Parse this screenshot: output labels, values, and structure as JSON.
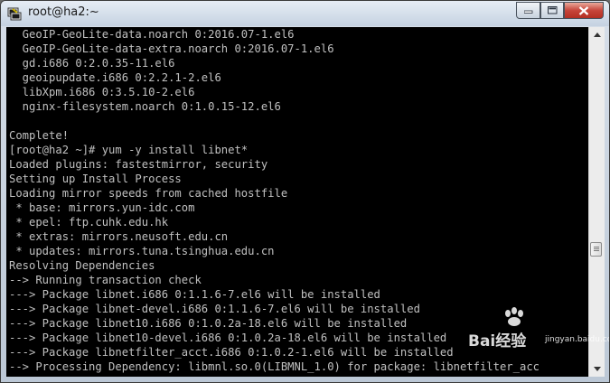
{
  "window": {
    "title": "root@ha2:~"
  },
  "icons": {
    "app": "putty-terminal-icon",
    "minimize": "minimize-icon",
    "maximize": "maximize-icon",
    "close": "close-icon"
  },
  "terminal": {
    "lines": [
      "  GeoIP-GeoLite-data.noarch 0:2016.07-1.el6",
      "  GeoIP-GeoLite-data-extra.noarch 0:2016.07-1.el6",
      "  gd.i686 0:2.0.35-11.el6",
      "  geoipupdate.i686 0:2.2.1-2.el6",
      "  libXpm.i686 0:3.5.10-2.el6",
      "  nginx-filesystem.noarch 0:1.0.15-12.el6",
      "",
      "Complete!",
      "[root@ha2 ~]# yum -y install libnet*",
      "Loaded plugins: fastestmirror, security",
      "Setting up Install Process",
      "Loading mirror speeds from cached hostfile",
      " * base: mirrors.yun-idc.com",
      " * epel: ftp.cuhk.edu.hk",
      " * extras: mirrors.neusoft.edu.cn",
      " * updates: mirrors.tuna.tsinghua.edu.cn",
      "Resolving Dependencies",
      "--> Running transaction check",
      "---> Package libnet.i686 0:1.1.6-7.el6 will be installed",
      "---> Package libnet-devel.i686 0:1.1.6-7.el6 will be installed",
      "---> Package libnet10.i686 0:1.0.2a-18.el6 will be installed",
      "---> Package libnet10-devel.i686 0:1.0.2a-18.el6 will be installed",
      "---> Package libnetfilter_acct.i686 0:1.0.2-1.el6 will be installed",
      "--> Processing Dependency: libmnl.so.0(LIBMNL_1.0) for package: libnetfilter_acc"
    ]
  },
  "watermark": {
    "text": "Bai经验",
    "sub": "jingyan.baidu.com"
  }
}
